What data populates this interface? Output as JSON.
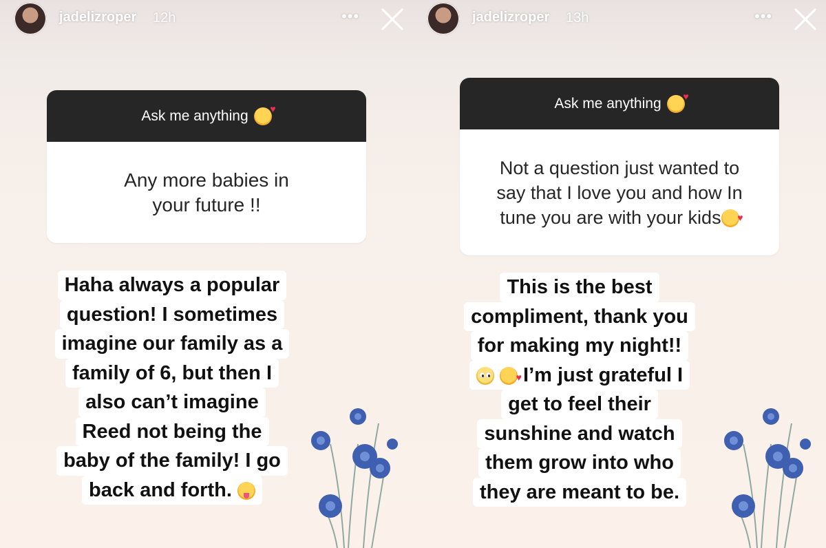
{
  "stories": [
    {
      "username": "jadelizroper",
      "time": "12h",
      "question_header": "Ask me anything",
      "question": [
        "Any more babies in",
        "your future !!"
      ],
      "answer": [
        "Haha always a popular",
        "question! I sometimes",
        "imagine our family as a",
        "family of 6, but then I",
        "also can’t imagine",
        "Reed not being the",
        "baby of the family! I go",
        "back and forth."
      ],
      "header_emoji": "smiling-face-with-hearts",
      "answer_emoji": "zany-face"
    },
    {
      "username": "jadelizroper",
      "time": "13h",
      "question_header": "Ask me anything",
      "question": [
        "Not a question just wanted to",
        "say that I love you and how In",
        "tune you are with your kids"
      ],
      "answer": [
        "This is the best",
        "compliment, thank you",
        "for making my night!!",
        "I’m just grateful I",
        "get to feel their",
        "sunshine and watch",
        "them grow into who",
        "they are meant to be."
      ],
      "header_emoji": "smiling-face-with-hearts",
      "answer_emoji": [
        "pleading-face",
        "smiling-face-with-hearts"
      ]
    }
  ],
  "colors": {
    "question_header_bg": "#262626",
    "flower_blue": "#3f5fb0"
  }
}
